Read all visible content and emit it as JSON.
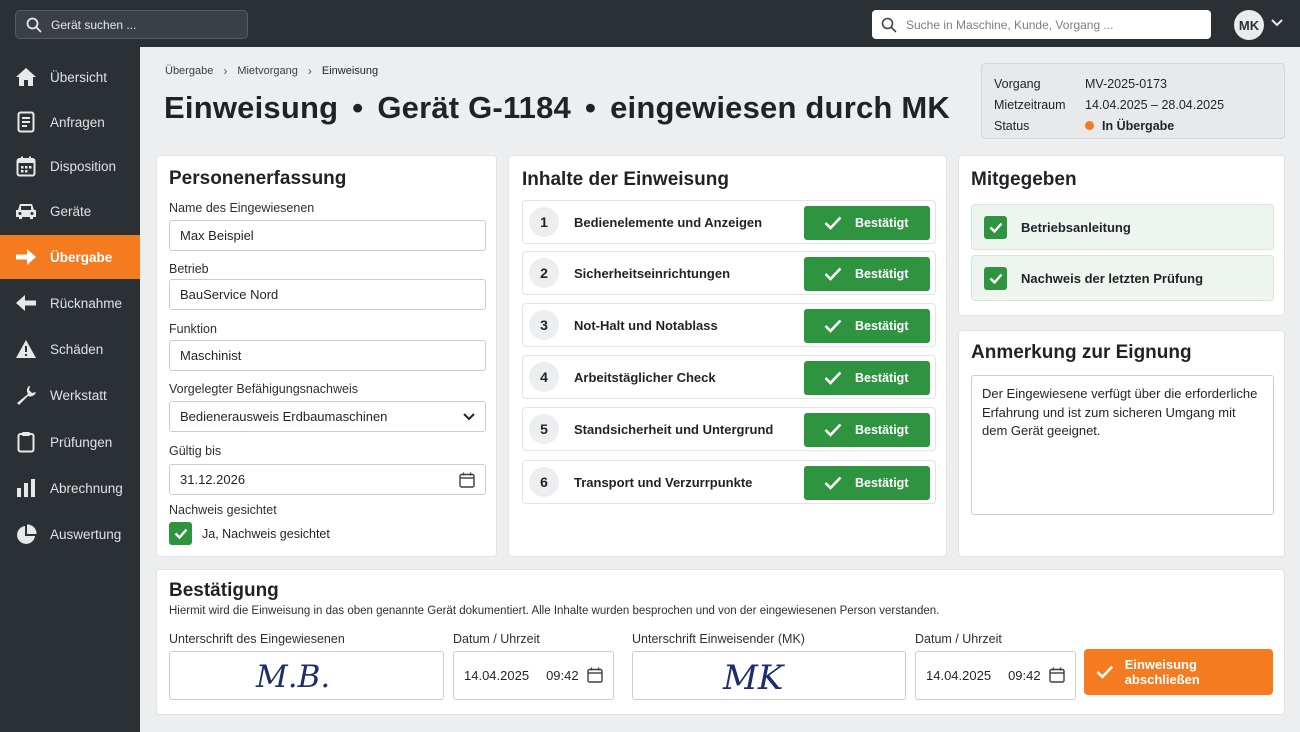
{
  "topbar": {
    "device_search_placeholder": "Gerät suchen ...",
    "global_search_placeholder": "Suche in Maschine, Kunde, Vorgang ...",
    "user_initials": "MK"
  },
  "sidebar": {
    "items": [
      {
        "label": "Übersicht",
        "icon": "home-icon"
      },
      {
        "label": "Anfragen",
        "icon": "document-icon"
      },
      {
        "label": "Disposition",
        "icon": "calendar-icon"
      },
      {
        "label": "Geräte",
        "icon": "vehicle-icon"
      },
      {
        "label": "Übergabe",
        "icon": "arrow-right-icon",
        "active": true
      },
      {
        "label": "Rücknahme",
        "icon": "arrow-left-icon"
      },
      {
        "label": "Schäden",
        "icon": "warning-icon"
      },
      {
        "label": "Werkstatt",
        "icon": "wrench-icon"
      },
      {
        "label": "Prüfungen",
        "icon": "clipboard-icon"
      },
      {
        "label": "Abrechnung",
        "icon": "bar-chart-icon"
      },
      {
        "label": "Auswertung",
        "icon": "pie-chart-icon"
      }
    ]
  },
  "breadcrumb": [
    "Übergabe",
    "Mietvorgang",
    "Einweisung"
  ],
  "title": {
    "part1": "Einweisung",
    "part2": "Gerät G-1184",
    "part3": "eingewiesen durch MK",
    "separator": "•"
  },
  "info": {
    "vorgang_label": "Vorgang",
    "vorgang_value": "MV-2025-0173",
    "zeitraum_label": "Mietzeitraum",
    "zeitraum_value": "14.04.2025 – 28.04.2025",
    "status_label": "Status",
    "status_value": "In Übergabe",
    "status_color": "#f47b20"
  },
  "person": {
    "title": "Personenerfassung",
    "name_label": "Name des Eingewiesenen",
    "name_value": "Max Beispiel",
    "company_label": "Betrieb",
    "company_value": "BauService Nord",
    "function_label": "Funktion",
    "function_value": "Maschinist",
    "proof_label": "Vorgelegter Befähigungsnachweis",
    "proof_value": "Bedienerausweis Erdbaumaschinen",
    "valid_label": "Gültig bis",
    "valid_value": "31.12.2026",
    "checked_label": "Nachweis gesichtet",
    "checked_value": "Ja, Nachweis gesichtet"
  },
  "instruction": {
    "title": "Inhalte der Einweisung",
    "items": [
      {
        "num": "1",
        "label": "Bedienelemente und Anzeigen",
        "status": "Bestätigt"
      },
      {
        "num": "2",
        "label": "Sicherheitseinrichtungen",
        "status": "Bestätigt"
      },
      {
        "num": "3",
        "label": "Not-Halt und Notablass",
        "status": "Bestätigt"
      },
      {
        "num": "4",
        "label": "Arbeitstäglicher Check",
        "status": "Bestätigt"
      },
      {
        "num": "5",
        "label": "Standsicherheit und Untergrund",
        "status": "Bestätigt"
      },
      {
        "num": "6",
        "label": "Transport und Verzurrpunkte",
        "status": "Bestätigt"
      }
    ]
  },
  "given": {
    "title": "Mitgegeben",
    "items": [
      "Betriebsanleitung",
      "Nachweis der letzten Prüfung"
    ]
  },
  "remark": {
    "title": "Anmerkung zur Eignung",
    "text": "Der Eingewiesene verfügt über die erforderliche Erfahrung und ist zum sicheren Umgang mit dem Gerät geeignet."
  },
  "confirmation": {
    "title": "Bestätigung",
    "subtitle": "Hiermit wird die Einweisung in das oben genannte Gerät dokumentiert. Alle Inhalte wurden besprochen und von der eingewiesenen Person verstanden.",
    "sig1_label": "Unterschrift des Eingewiesenen",
    "sig1_text": "M.B.",
    "date1_label": "Datum / Uhrzeit",
    "date1_value": "14.04.2025",
    "time1_value": "09:42",
    "sig2_label": "Unterschrift Einweisender (MK)",
    "sig2_text": "MK",
    "date2_label": "Datum / Uhrzeit",
    "date2_value": "14.04.2025",
    "time2_value": "09:42",
    "finish_button": "Einweisung abschließen"
  }
}
